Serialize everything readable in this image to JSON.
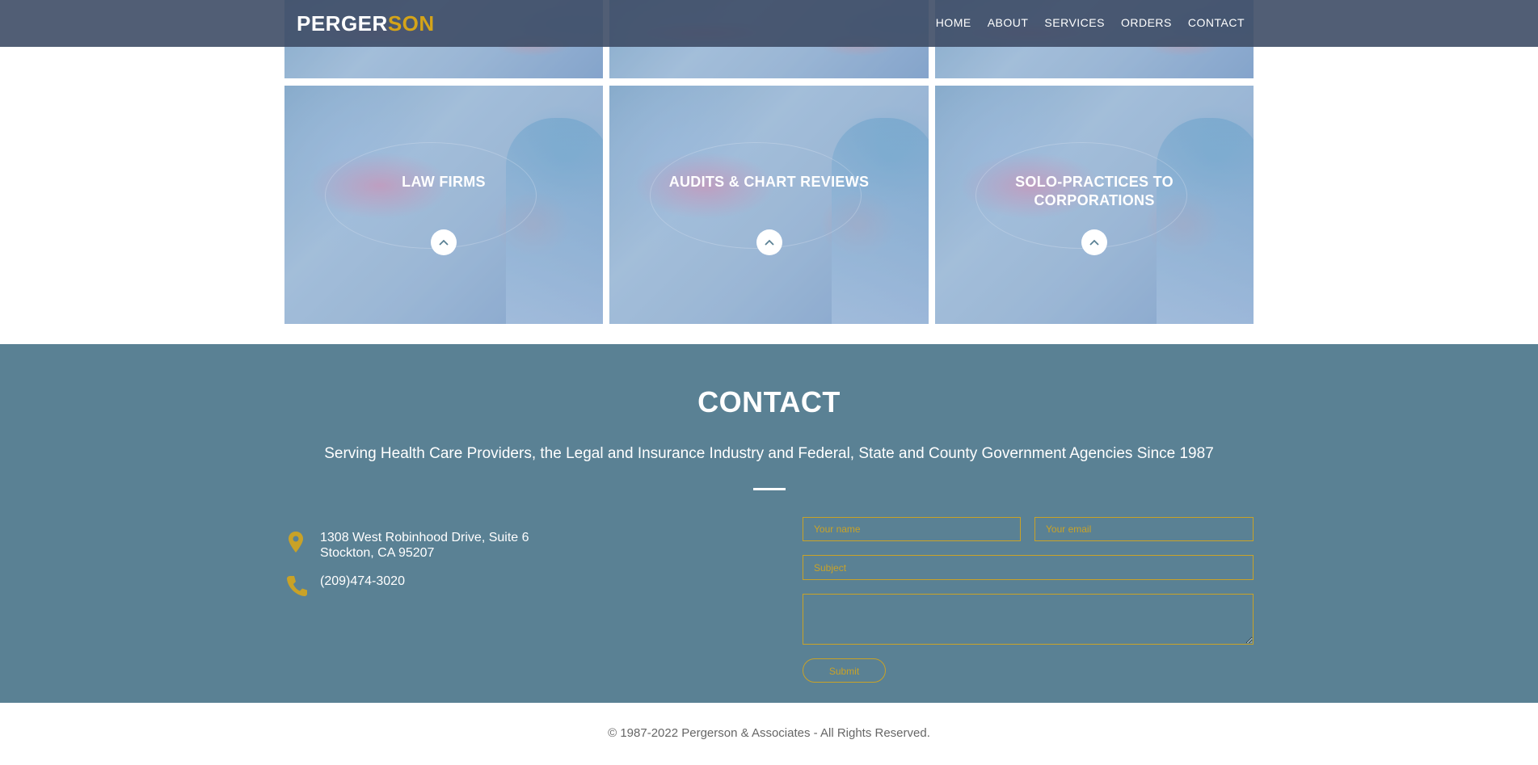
{
  "header": {
    "logo_part1": "PERGER",
    "logo_part2": "SON",
    "nav": [
      "HOME",
      "ABOUT",
      "SERVICES",
      "ORDERS",
      "CONTACT"
    ]
  },
  "services": {
    "tiles": [
      {
        "title": "LAW FIRMS"
      },
      {
        "title": "AUDITS & CHART REVIEWS"
      },
      {
        "title": "SOLO-PRACTICES TO CORPORATIONS"
      }
    ]
  },
  "contact": {
    "title": "CONTACT",
    "subtitle": "Serving Health Care Providers, the Legal and Insurance Industry and Federal, State and County Government Agencies Since 1987",
    "address_line1": "1308 West Robinhood Drive, Suite 6",
    "address_line2": "Stockton, CA 95207",
    "phone": "(209)474-3020",
    "form": {
      "name_placeholder": "Your name",
      "email_placeholder": "Your email",
      "subject_placeholder": "Subject",
      "message_placeholder": "",
      "submit_label": "Submit"
    }
  },
  "footer": {
    "copyright": "© 1987-2022 Pergerson & Associates - All Rights Reserved."
  },
  "colors": {
    "header_bg": "#3e4c66",
    "accent": "#d4a419",
    "contact_bg": "#5a8194"
  },
  "icons": [
    "map-pin-icon",
    "phone-icon",
    "chevron-up-icon"
  ]
}
